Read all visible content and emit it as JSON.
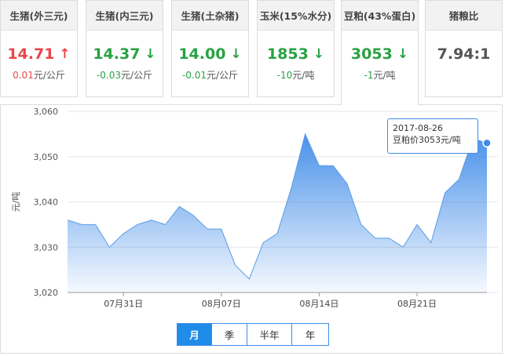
{
  "cards": [
    {
      "title": "生猪(外三元)",
      "price": "14.71",
      "trend": "up",
      "change": "0.01",
      "unit": "元/公斤"
    },
    {
      "title": "生猪(内三元)",
      "price": "14.37",
      "trend": "down",
      "change": "-0.03",
      "unit": "元/公斤"
    },
    {
      "title": "生猪(土杂猪)",
      "price": "14.00",
      "trend": "down",
      "change": "-0.01",
      "unit": "元/公斤"
    },
    {
      "title": "玉米(15%水分)",
      "price": "1853",
      "trend": "down",
      "change": "-10",
      "unit": "元/吨"
    },
    {
      "title": "豆粕(43%蛋白)",
      "price": "3053",
      "trend": "down",
      "change": "-1",
      "unit": "元/吨",
      "active": true
    },
    {
      "title": "猪粮比",
      "price": "7.94:1",
      "trend": "none",
      "change": "",
      "unit": ""
    }
  ],
  "arrows": {
    "up": "↑",
    "down": "↓"
  },
  "tooltip": {
    "date": "2017-08-26",
    "text": "豆粕价3053元/吨"
  },
  "period_buttons": [
    "月",
    "季",
    "半年",
    "年"
  ],
  "selected_period": "月",
  "colors": {
    "up": "#e8474b",
    "down": "#27a243",
    "line": "#3f8be8",
    "accent": "#1f8ce8"
  },
  "chart_data": {
    "type": "area",
    "ylabel": "元/吨",
    "ylim": [
      3020,
      3060
    ],
    "yticks": [
      3020,
      3030,
      3040,
      3050,
      3060
    ],
    "ytick_labels": [
      "3,020",
      "3,030",
      "3,040",
      "3,050",
      "3,060"
    ],
    "x": [
      "2017-07-27",
      "2017-07-28",
      "2017-07-29",
      "2017-07-30",
      "2017-07-31",
      "2017-08-01",
      "2017-08-02",
      "2017-08-03",
      "2017-08-04",
      "2017-08-05",
      "2017-08-06",
      "2017-08-07",
      "2017-08-08",
      "2017-08-09",
      "2017-08-10",
      "2017-08-11",
      "2017-08-12",
      "2017-08-13",
      "2017-08-14",
      "2017-08-15",
      "2017-08-16",
      "2017-08-17",
      "2017-08-18",
      "2017-08-19",
      "2017-08-20",
      "2017-08-21",
      "2017-08-22",
      "2017-08-23",
      "2017-08-24",
      "2017-08-25",
      "2017-08-26"
    ],
    "values": [
      3036,
      3035,
      3035,
      3030,
      3033,
      3035,
      3036,
      3035,
      3039,
      3037,
      3034,
      3034,
      3026,
      3023,
      3031,
      3033,
      3043,
      3055,
      3048,
      3048,
      3044,
      3035,
      3032,
      3032,
      3030,
      3035,
      3031,
      3042,
      3045,
      3054,
      3053
    ],
    "xtick_labels": [
      {
        "label": "07月31日",
        "index": 4
      },
      {
        "label": "08月07日",
        "index": 11
      },
      {
        "label": "08月14日",
        "index": 18
      },
      {
        "label": "08月21日",
        "index": 25
      }
    ],
    "highlight_index": 30,
    "grid": true
  }
}
